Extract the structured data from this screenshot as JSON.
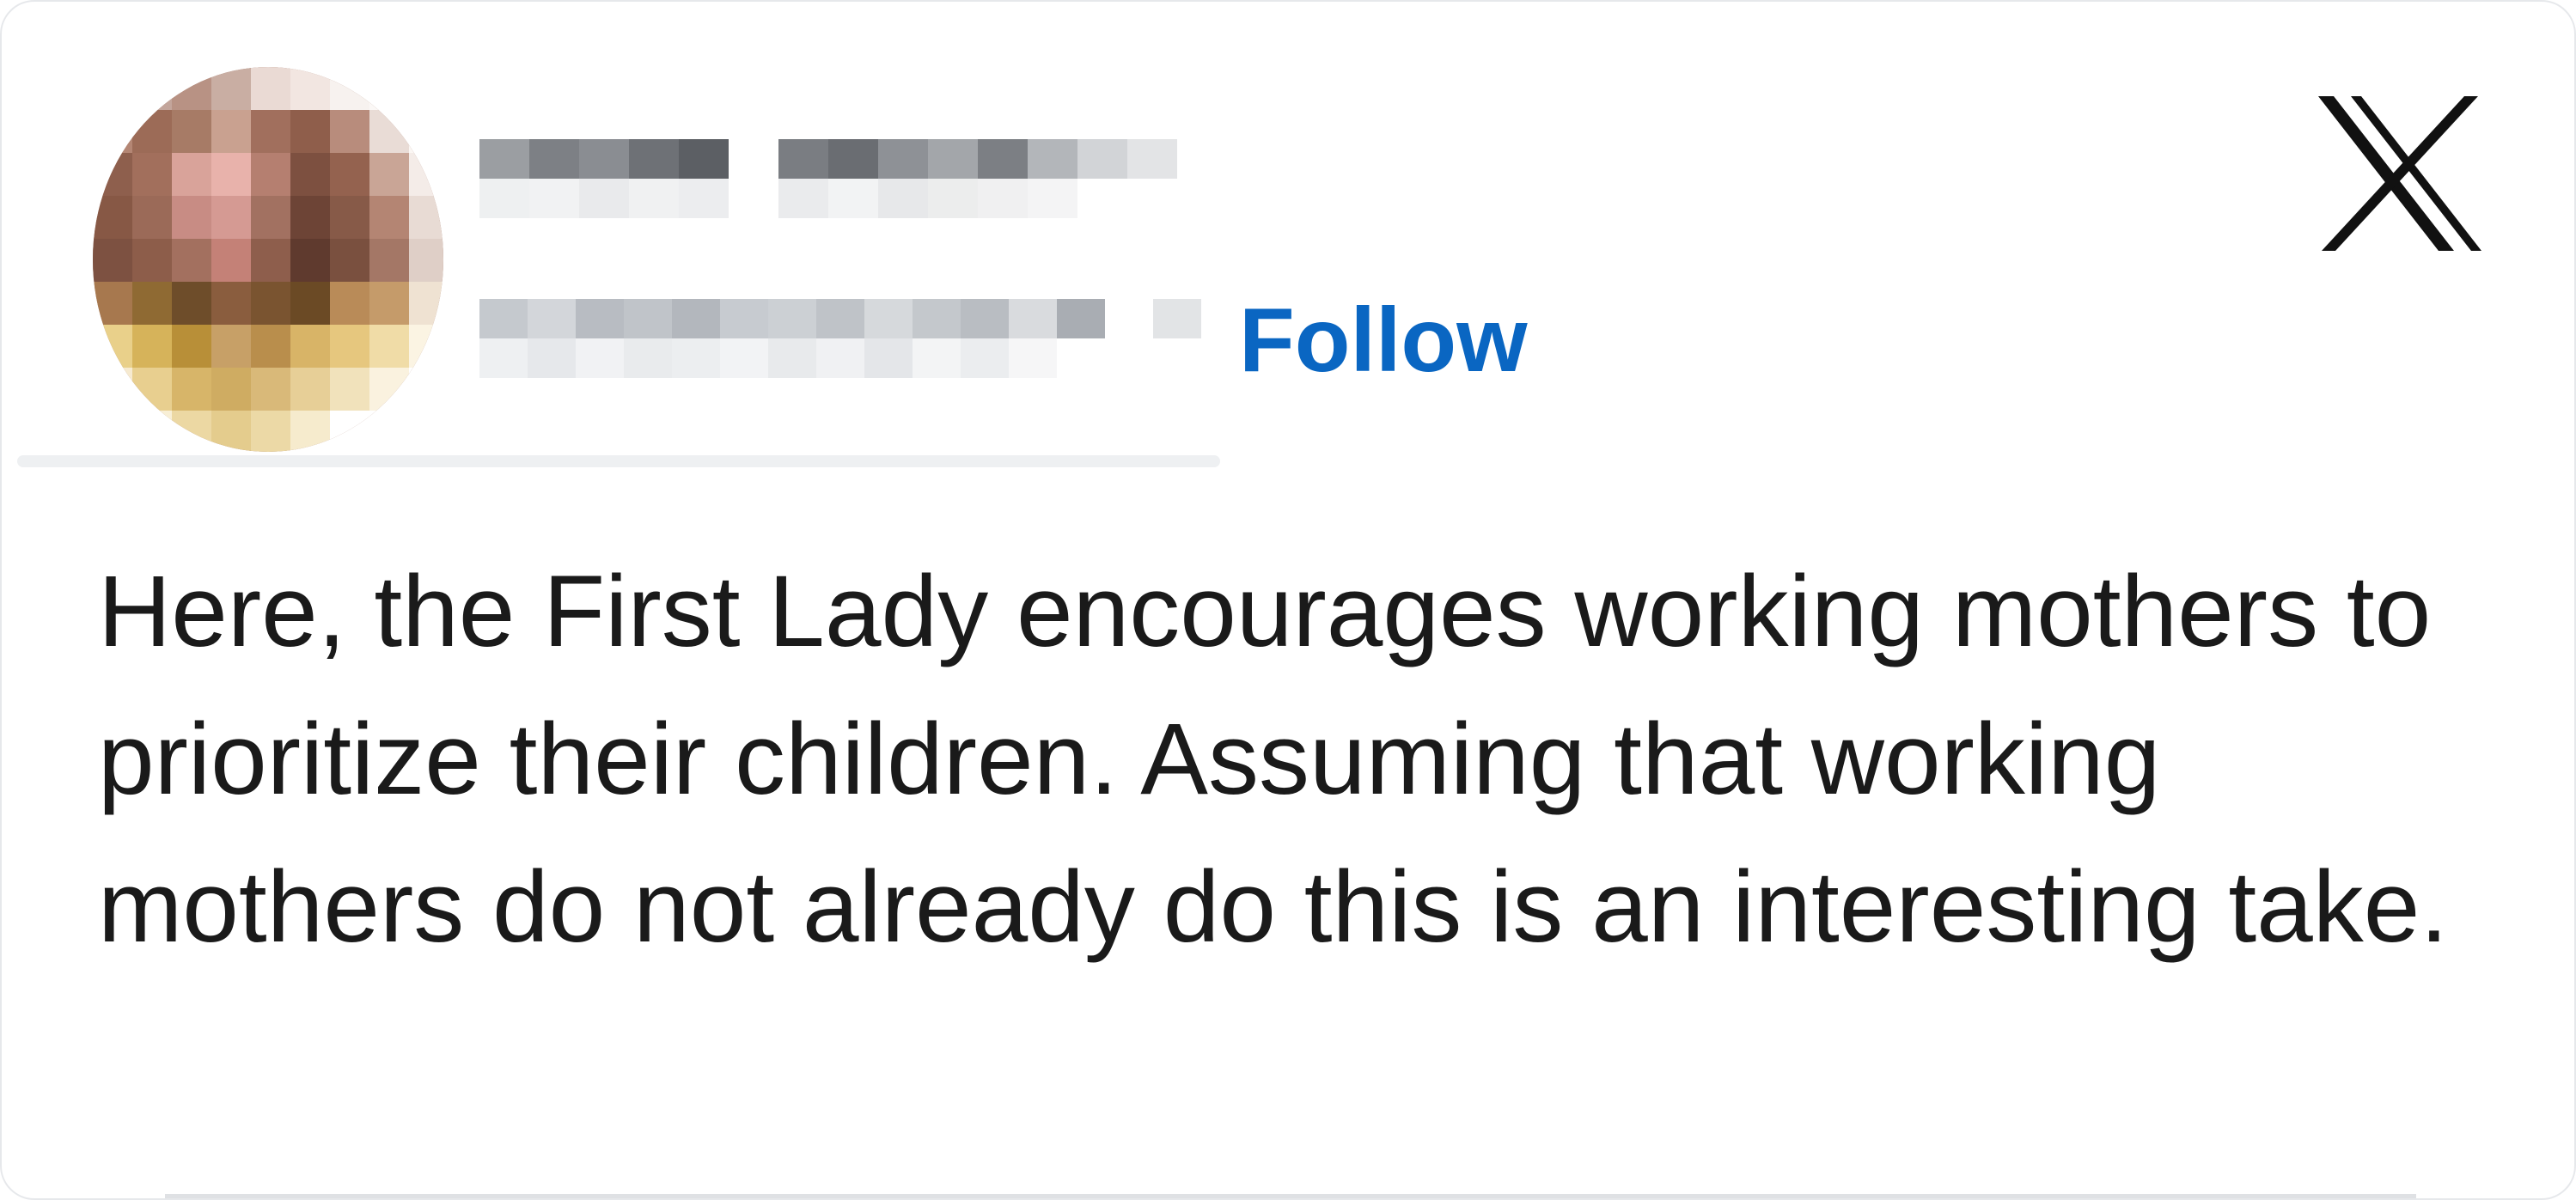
{
  "author": {
    "name": "",
    "handle": "",
    "avatar_icon": "profile-photo-pixelated"
  },
  "follow_label": "Follow",
  "platform_icon": "x-logo-icon",
  "post": {
    "text": "Here, the First Lady encourages working mothers to prioritize their children. Assuming that working mothers do not already do this is an interesting take."
  },
  "colors": {
    "accent": "#0a66c2",
    "text": "#1a1a1a",
    "border": "#e6e8eb"
  }
}
